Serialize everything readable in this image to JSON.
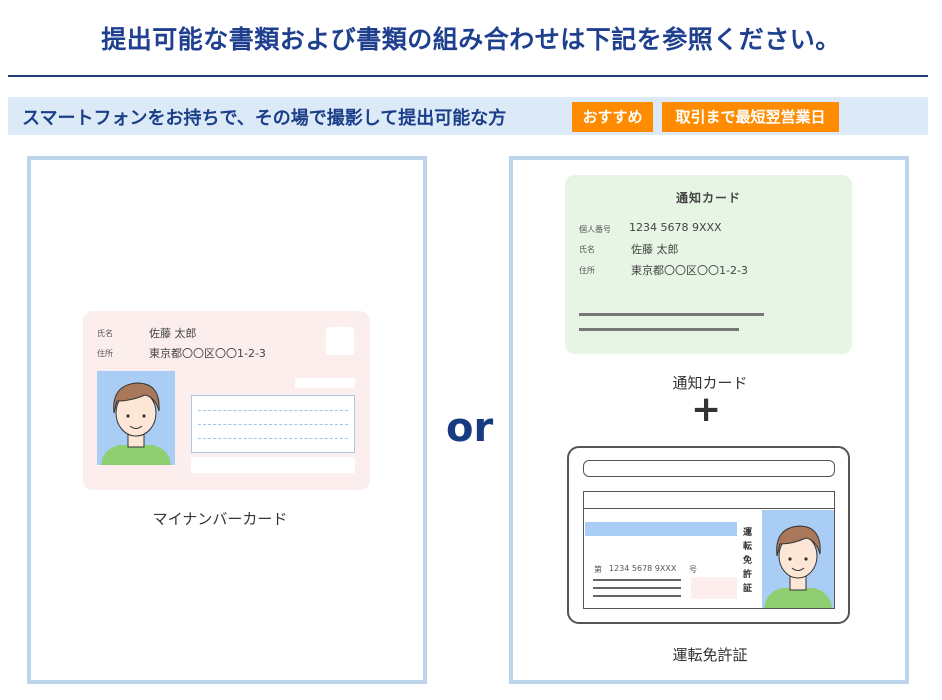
{
  "header": {
    "title": "提出可能な書類および書類の組み合わせは下記を参照ください。"
  },
  "band": {
    "text": "スマートフォンをお持ちで、その場で撮影して提出可能な方",
    "tags": [
      "おすすめ",
      "取引まで最短翌営業日"
    ]
  },
  "or_label": "or",
  "plus_label": "+",
  "mynumber_card": {
    "name_label": "氏名",
    "name_value": "佐藤 太郎",
    "address_label": "住所",
    "address_value": "東京都〇〇区〇〇1-2-3",
    "caption": "マイナンバーカード"
  },
  "notice_card": {
    "title": "通知カード",
    "number_label": "個人番号",
    "number_value": "1234 5678 9XXX",
    "name_label": "氏名",
    "name_value": "佐藤 太郎",
    "address_label": "住所",
    "address_value": "東京都〇〇区〇〇1-2-3",
    "caption": "通知カード"
  },
  "license_card": {
    "number_prefix": "第",
    "number_value": "1234 5678 9XXX",
    "number_suffix": "号",
    "vertical_label": "運転免許証",
    "caption": "運転免許証"
  },
  "colors": {
    "title": "#1f3f8f",
    "band_bg": "#dceaf7",
    "tag_bg": "#ff8c00",
    "panel_border": "#bcd5ea",
    "mynumber_bg": "#fdeeee",
    "notice_bg": "#e6f5e4",
    "photo_bg": "#a9cdf4"
  }
}
